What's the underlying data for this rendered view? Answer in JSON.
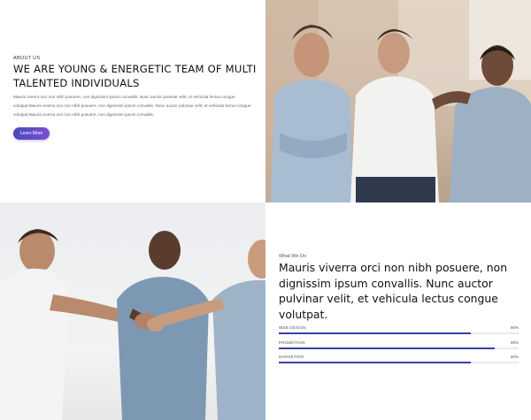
{
  "about": {
    "label": "ABOUT US",
    "title": "WE ARE YOUNG & ENERGETIC TEAM OF MULTI TALENTED INDIVIDUALS",
    "body": "Mauris viverra orci non nibh posuere, non dignissim ipsum convallis. Nunc auctor pulvinar velit, et vehicula lectus congue volutpat.Mauris viverra orci non nibh posuere, non dignissim ipsum convallis. Nunc auctor pulvinar velit, et vehicula lectus congue volutpat.Mauris viverra orci non nibh posuere, non dignissim ipsum convallis.",
    "button_label": "Learn More"
  },
  "what_we_do": {
    "label": "What We Do",
    "heading": "Mauris viverra orci non nibh posuere, non dignissim ipsum convallis. Nunc auctor pulvinar velit, et vehicula lectus congue volutpat.",
    "skills": [
      {
        "name": "WEB DESIGN",
        "percent_label": "80%",
        "value": 80
      },
      {
        "name": "PROMOTION",
        "percent_label": "90%",
        "value": 90
      },
      {
        "name": "MARKETING",
        "percent_label": "80%",
        "value": 80
      }
    ]
  },
  "colors": {
    "accent": "#3c3fa8",
    "button_gradient_start": "#4b49b8",
    "button_gradient_end": "#7a4fd6"
  }
}
